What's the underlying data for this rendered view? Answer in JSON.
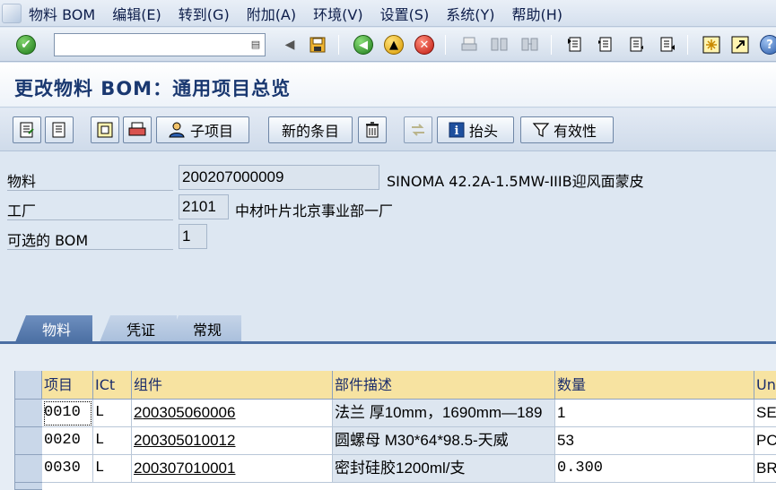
{
  "menu": {
    "items": [
      "物料 BOM",
      "编辑(E)",
      "转到(G)",
      "附加(A)",
      "环境(V)",
      "设置(S)",
      "系统(Y)",
      "帮助(H)"
    ]
  },
  "toolbar": {
    "command_value": "",
    "icons": [
      "check-icon",
      "dropdown-icon",
      "back-arrow-icon",
      "save-icon",
      "back-icon",
      "exit-icon",
      "cancel-icon",
      "print-icon",
      "find-icon",
      "find-next-icon",
      "first-page-icon",
      "previous-page-icon",
      "next-page-icon",
      "last-page-icon",
      "create-session-icon",
      "shortcut-icon",
      "help-icon"
    ]
  },
  "page": {
    "title": "更改物料 BOM：通用项目总览"
  },
  "app_toolbar": {
    "subitem_label": "子项目",
    "new_entries_label": "新的条目",
    "header_label": "抬头",
    "validity_label": "有效性"
  },
  "header": {
    "material_label": "物料",
    "material_value": "200207000009",
    "material_desc": "SINOMA 42.2A-1.5MW-IIIB迎风面蒙皮",
    "plant_label": "工厂",
    "plant_value": "2101",
    "plant_desc": "中材叶片北京事业部一厂",
    "alt_bom_label": "可选的 BOM",
    "alt_bom_value": "1"
  },
  "tabs": [
    {
      "label": "物料"
    },
    {
      "label": "凭证"
    },
    {
      "label": "常规"
    }
  ],
  "table": {
    "columns": [
      "项目",
      "ICt",
      "组件",
      "部件描述",
      "数量",
      "Un"
    ],
    "rows": [
      {
        "item": "0010",
        "ict": "L",
        "component": "200305060006",
        "desc": "法兰 厚10mm，1690mm—189",
        "qty": "1",
        "un": "SE"
      },
      {
        "item": "0020",
        "ict": "L",
        "component": "200305010012",
        "desc": "圆螺母 M30*64*98.5-天威",
        "qty": "53",
        "un": "PC"
      },
      {
        "item": "0030",
        "ict": "L",
        "component": "200307010001",
        "desc": "密封硅胶1200ml/支",
        "qty": "0.300",
        "un": "BR"
      }
    ]
  },
  "colors": {
    "title": "#1a3870",
    "header_cell": "#f7e3a1",
    "tab_active": "#4b6fa3"
  }
}
